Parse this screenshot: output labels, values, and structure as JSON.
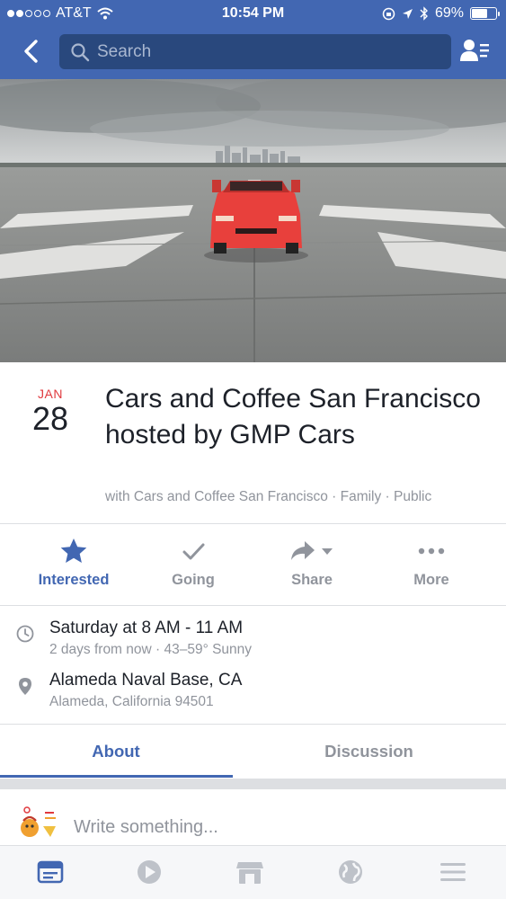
{
  "status_bar": {
    "carrier": "AT&T",
    "time": "10:54 PM",
    "battery": "69%",
    "battery_level": 0.69,
    "signal_bars": 2
  },
  "nav": {
    "search_placeholder": "Search"
  },
  "event": {
    "month": "JAN",
    "day": "28",
    "title": "Cars and Coffee San Francisco hosted by GMP Cars",
    "subtitle": "with Cars and Coffee San Francisco · Family · Public"
  },
  "actions": [
    {
      "label": "Interested",
      "icon": "star-icon",
      "active": true
    },
    {
      "label": "Going",
      "icon": "checkmark-icon",
      "active": false
    },
    {
      "label": "Share",
      "icon": "share-arrow-icon",
      "active": false
    },
    {
      "label": "More",
      "icon": "more-dots-icon",
      "active": false
    }
  ],
  "details": {
    "time_main": "Saturday at 8 AM - 11 AM",
    "time_sub": "2 days from now · 43–59° Sunny",
    "place_main": "Alameda Naval Base, CA",
    "place_sub": "Alameda, California 94501"
  },
  "tabs": [
    {
      "label": "About",
      "active": true
    },
    {
      "label": "Discussion",
      "active": false
    }
  ],
  "composer": {
    "placeholder": "Write something..."
  },
  "tabbar": [
    "news-feed-icon",
    "video-play-icon",
    "marketplace-icon",
    "notifications-globe-icon",
    "menu-icon"
  ],
  "colors": {
    "brand": "#4267b2",
    "search_bg": "#29487d",
    "date_red": "#e0393e",
    "muted": "#90949c",
    "car_red": "#e8403c"
  }
}
